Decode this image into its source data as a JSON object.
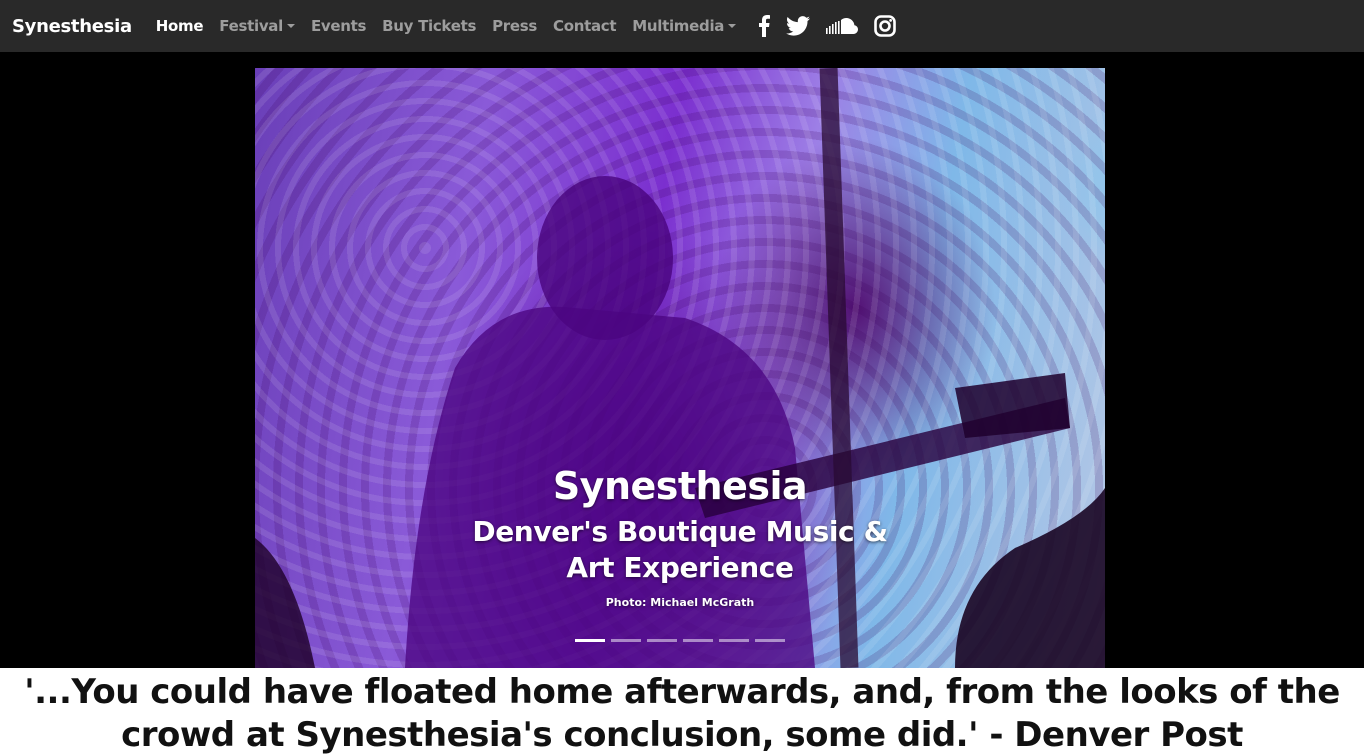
{
  "navbar": {
    "brand": "Synesthesia",
    "items": [
      {
        "label": "Home",
        "active": true,
        "dropdown": false
      },
      {
        "label": "Festival",
        "active": false,
        "dropdown": true
      },
      {
        "label": "Events",
        "active": false,
        "dropdown": false
      },
      {
        "label": "Buy Tickets",
        "active": false,
        "dropdown": false
      },
      {
        "label": "Press",
        "active": false,
        "dropdown": false
      },
      {
        "label": "Contact",
        "active": false,
        "dropdown": false
      },
      {
        "label": "Multimedia",
        "active": false,
        "dropdown": true
      }
    ],
    "social_icons": [
      "facebook-icon",
      "twitter-icon",
      "soundcloud-icon",
      "instagram-icon"
    ]
  },
  "carousel": {
    "title": "Synesthesia",
    "subtitle": "Denver's Boutique Music & Art Experience",
    "credit": "Photo: Michael McGrath",
    "slide_count": 6,
    "active_slide": 1
  },
  "quote": {
    "text": "'...You could have floated home afterwards, and, from the looks of the crowd at Synesthesia's conclusion, some did.' - Denver Post"
  },
  "colors": {
    "navbar_bg": "#292929",
    "nav_text": "#9d9d9d",
    "nav_active": "#ffffff",
    "page_bg": "#000000"
  }
}
